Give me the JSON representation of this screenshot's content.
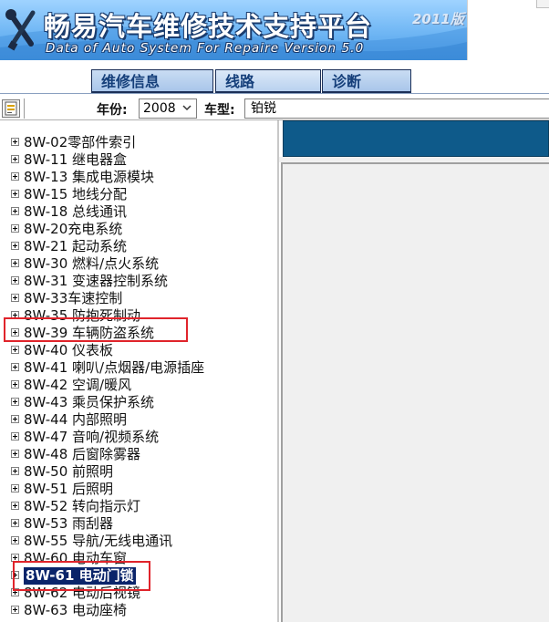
{
  "banner": {
    "title": "畅易汽车维修技术支持平台",
    "version": "2011版",
    "subtitle": "Data of Auto System For Repaire Version 5.0",
    "icon": "wrench-screwdriver-icon"
  },
  "tabs": [
    {
      "label": "维修信息",
      "active": false
    },
    {
      "label": "线路",
      "active": true
    },
    {
      "label": "诊断",
      "active": false
    }
  ],
  "selector": {
    "year_label": "年份:",
    "year_value": "2008",
    "model_label": "车型:",
    "model_value": "铂锐"
  },
  "tree": {
    "items": [
      {
        "label": "8W-02零部件索引"
      },
      {
        "label": "8W-11 继电器盒"
      },
      {
        "label": "8W-13 集成电源模块"
      },
      {
        "label": "8W-15 地线分配"
      },
      {
        "label": "8W-18 总线通讯"
      },
      {
        "label": "8W-20充电系统"
      },
      {
        "label": "8W-21 起动系统"
      },
      {
        "label": "8W-30 燃料/点火系统"
      },
      {
        "label": "8W-31 变速器控制系统"
      },
      {
        "label": "8W-33车速控制"
      },
      {
        "label": "8W-35 防抱死制动"
      },
      {
        "label": "8W-39 车辆防盗系统"
      },
      {
        "label": "8W-40 仪表板"
      },
      {
        "label": "8W-41 喇叭/点烟器/电源插座"
      },
      {
        "label": "8W-42 空调/暖风"
      },
      {
        "label": "8W-43 乘员保护系统"
      },
      {
        "label": "8W-44 内部照明"
      },
      {
        "label": "8W-47 音响/视频系统"
      },
      {
        "label": "8W-48 后窗除雾器"
      },
      {
        "label": "8W-50 前照明"
      },
      {
        "label": "8W-51 后照明"
      },
      {
        "label": "8W-52 转向指示灯"
      },
      {
        "label": "8W-53 雨刮器"
      },
      {
        "label": "8W-55 导航/无线电通讯"
      },
      {
        "label": "8W-60 电动车窗"
      },
      {
        "label": "8W-61 电动门锁"
      },
      {
        "label": "8W-62 电动后视镜"
      },
      {
        "label": "8W-63 电动座椅"
      }
    ],
    "selected_label": "8W-61 电动门锁"
  },
  "colors": {
    "highlight_box": "#e0242b",
    "selection_bg": "#0a246a",
    "right_header": "#0e5a8a",
    "tab_text": "#153f7a"
  }
}
